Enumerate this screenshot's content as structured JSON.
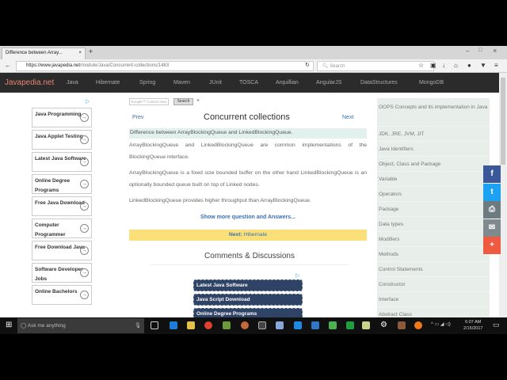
{
  "browser": {
    "tab_title": "Difference between Array...",
    "new_tab": "+",
    "url_host": "https://www.javapedia.net",
    "url_path": "/module/Java/Concurrent-collections/1483",
    "search_placeholder": "Search",
    "window_controls": [
      "–",
      "□",
      "×"
    ]
  },
  "nav": {
    "brand": "Javapedia.net",
    "links": [
      "Java",
      "Hibernate",
      "Spring",
      "Maven",
      "JUnit",
      "TOSCA",
      "Arquillian",
      "AngularJS",
      "DataStructures",
      "MongoDB"
    ]
  },
  "left_ads": [
    "Java Programming",
    "Java Applet Testing",
    "Latest Java Software",
    "Online Degree Programs",
    "Free Java Download",
    "Computer Programmer",
    "Free Download Java",
    "Software Developer Jobs",
    "Online Bachelors"
  ],
  "main": {
    "search_placeholder": "Google™ Custom Sea",
    "search_button": "Search",
    "clear": "×",
    "prev": "Prev",
    "next": "Next",
    "title": "Concurrent collections",
    "question": "Difference between ArrayBlockingQueue and LinkedBlockingQueue.",
    "paragraphs": [
      "ArrayBlockingQueue and LinkedBlockingQueue are common implementations of the BlockingQueue interface.",
      "ArrayBlockingQueue is a fixed size bounded buffer on the other hand LinkedBlockingQueue is an optionally bounded queue built on top of Linked nodes.",
      "LinkedBlockingQueue provides higher throughput than ArrayBlockingQueue."
    ],
    "show_more": "Show more question and Answers...",
    "next_label": "Next:",
    "next_topic": "Hibernate",
    "comments_title": "Comments & Discussions",
    "bottom_ads": [
      "Latest Java Software",
      "Java Script Download",
      "Online Degree Programs"
    ]
  },
  "right_menu": [
    "OOPS Concepts and its implementation in Java",
    "JDK, JRE, JVM, JIT",
    "Java Identifiers",
    "Object, Class and Package",
    "Variable",
    "Operators",
    "Package",
    "Data types",
    "Modifiers",
    "Methods",
    "Control Statements",
    "Constructor",
    "Interface",
    "Abstract Class"
  ],
  "social": [
    {
      "icon": "f",
      "color": "#3b5998"
    },
    {
      "icon": "t",
      "color": "#1da1f2"
    },
    {
      "icon": "print",
      "color": "#6d7a80"
    },
    {
      "icon": "mail",
      "color": "#7f8a8f"
    },
    {
      "icon": "+",
      "color": "#f05a40"
    }
  ],
  "taskbar": {
    "search": "Ask me anything",
    "time": "6:07 AM",
    "date": "2/15/2017"
  }
}
